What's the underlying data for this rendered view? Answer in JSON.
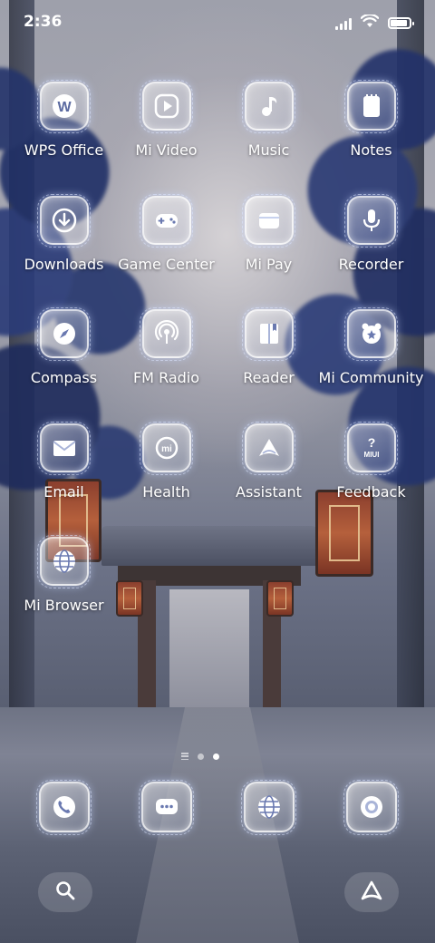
{
  "status_bar": {
    "time": "2:36",
    "signal_icon": "signal-icon",
    "wifi_icon": "wifi-icon",
    "battery_icon": "battery-icon",
    "battery_level": 0.8
  },
  "apps": [
    {
      "label": "WPS Office",
      "icon": "wps-icon"
    },
    {
      "label": "Mi Video",
      "icon": "play-icon"
    },
    {
      "label": "Music",
      "icon": "music-note-icon"
    },
    {
      "label": "Notes",
      "icon": "notes-icon"
    },
    {
      "label": "Downloads",
      "icon": "download-icon"
    },
    {
      "label": "Game Center",
      "icon": "gamepad-icon"
    },
    {
      "label": "Mi Pay",
      "icon": "wallet-icon"
    },
    {
      "label": "Recorder",
      "icon": "microphone-icon"
    },
    {
      "label": "Compass",
      "icon": "compass-icon"
    },
    {
      "label": "FM Radio",
      "icon": "radio-icon"
    },
    {
      "label": "Reader",
      "icon": "book-icon"
    },
    {
      "label": "Mi Community",
      "icon": "community-icon"
    },
    {
      "label": "Email",
      "icon": "mail-icon"
    },
    {
      "label": "Health",
      "icon": "health-icon"
    },
    {
      "label": "Assistant",
      "icon": "assistant-icon"
    },
    {
      "label": "Feedback",
      "icon": "feedback-icon"
    },
    {
      "label": "Mi Browser",
      "icon": "browser-globe-icon"
    }
  ],
  "icon_text": {
    "wps": "W",
    "health": "mi",
    "feedback": "MIUI"
  },
  "page_indicator": {
    "pages": 2,
    "active": 2
  },
  "dock": [
    {
      "icon": "phone-icon"
    },
    {
      "icon": "messages-icon"
    },
    {
      "icon": "browser-globe-icon"
    },
    {
      "icon": "camera-icon"
    }
  ],
  "bottom_bar": {
    "search_icon": "search-icon",
    "assistant_icon": "assistant-triangle-icon"
  },
  "colors": {
    "icon_glow": "#c8d7ff",
    "foliage": "#24346b",
    "lantern": "#b5603c"
  }
}
